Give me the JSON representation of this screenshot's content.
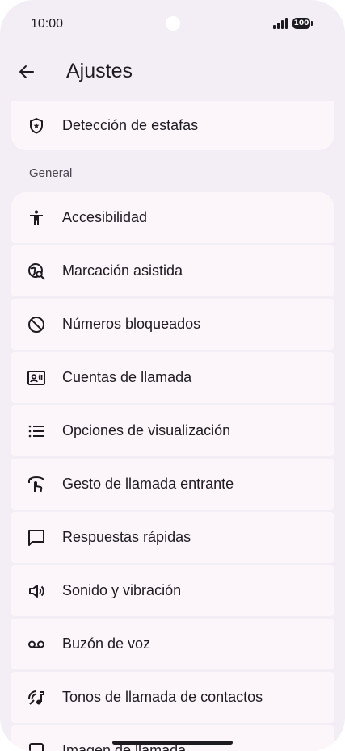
{
  "status_bar": {
    "time": "10:00",
    "battery": "100"
  },
  "app_bar": {
    "title": "Ajustes"
  },
  "top_item": {
    "label": "Detección de estafas",
    "icon": "shield-star-icon"
  },
  "section": {
    "header": "General"
  },
  "items": [
    {
      "label": "Accesibilidad",
      "icon": "accessibility-icon"
    },
    {
      "label": "Marcación asistida",
      "icon": "globe-search-icon"
    },
    {
      "label": "Números bloqueados",
      "icon": "block-icon"
    },
    {
      "label": "Cuentas de llamada",
      "icon": "contact-card-icon"
    },
    {
      "label": "Opciones de visualización",
      "icon": "list-icon"
    },
    {
      "label": "Gesto de llamada entrante",
      "icon": "swipe-gesture-icon"
    },
    {
      "label": "Respuestas rápidas",
      "icon": "chat-bubble-icon"
    },
    {
      "label": "Sonido y vibración",
      "icon": "volume-icon"
    },
    {
      "label": "Buzón de voz",
      "icon": "voicemail-icon"
    },
    {
      "label": "Tonos de llamada de contactos",
      "icon": "ringtone-icon"
    },
    {
      "label": "Imagen de llamada",
      "icon": "call-image-icon"
    }
  ],
  "colors": {
    "background": "#f3eef5",
    "card": "#fcf6fb",
    "text": "#1d1b20"
  }
}
